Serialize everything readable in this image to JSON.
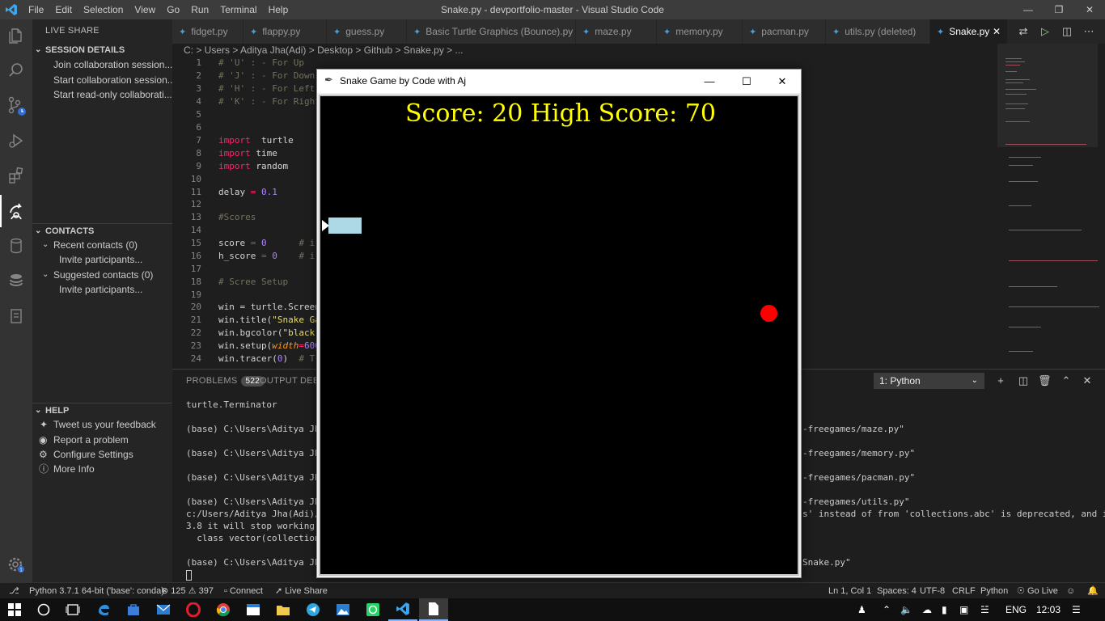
{
  "titlebar": {
    "menu": [
      "File",
      "Edit",
      "Selection",
      "View",
      "Go",
      "Run",
      "Terminal",
      "Help"
    ],
    "title": "Snake.py - devportfolio-master - Visual Studio Code"
  },
  "sidebar": {
    "header": "LIVE SHARE",
    "session_title": "SESSION DETAILS",
    "session_items": [
      "Join collaboration session...",
      "Start collaboration session...",
      "Start read-only collaborati..."
    ],
    "contacts_title": "CONTACTS",
    "recent_contacts": "Recent contacts (0)",
    "invite_recent": "Invite participants...",
    "suggested_contacts": "Suggested contacts (0)",
    "invite_suggested": "Invite participants...",
    "help_title": "HELP",
    "help_items": [
      "Tweet us your feedback",
      "Report a problem",
      "Configure Settings",
      "More Info"
    ]
  },
  "tabs": [
    "fidget.py",
    "flappy.py",
    "guess.py",
    "Basic Turtle Graphics (Bounce).py",
    "maze.py",
    "memory.py",
    "pacman.py",
    "utils.py (deleted)",
    "Snake.py"
  ],
  "breadcrumb": "C: > Users > Aditya Jha(Adi) > Desktop > Github > Snake.py > ...",
  "editor": {
    "line_numbers": [
      "1",
      "2",
      "3",
      "4",
      "5",
      "6",
      "7",
      "8",
      "9",
      "10",
      "11",
      "12",
      "13",
      "14",
      "15",
      "16",
      "17",
      "18",
      "19",
      "20",
      "21",
      "22",
      "23",
      "24"
    ],
    "lines": {
      "l1": "# 'U' : - For Up",
      "l2": "# 'J' : - For Down",
      "l3": "# 'H' : - For Left",
      "l4": "# 'K' : - For Right",
      "l7_kw": "import",
      "l7_rest": "  turtle",
      "l8_kw": "import",
      "l8_rest": " time",
      "l9_kw": "import",
      "l9_rest": " random",
      "l11_a": "delay",
      "l11_op": " = ",
      "l11_n": "0.1",
      "l13": "#Scores",
      "l15_a": "score",
      "l15_op": " = ",
      "l15_n": "0",
      "l15_c": "      # i",
      "l16_a": "h_score",
      "l16_op": " = ",
      "l16_n": "0",
      "l16_c": "    # i",
      "l18": "# Scree Setup",
      "l20": "win = turtle.Screen",
      "l21_a": "win.title(",
      "l21_s": "\"Snake Ga",
      "l22_a": "win.bgcolor(",
      "l22_s": "\"black\"",
      "l23_a": "win.setup(",
      "l23_arg": "width",
      "l23_b": "=",
      "l23_n": "600",
      "l24_a": "win.tracer(",
      "l24_n": "0",
      "l24_b": ")",
      "l24_c": "  # T"
    }
  },
  "panel": {
    "problems_label": "PROBLEMS",
    "problems_count": "522",
    "output_label": "OUTPUT",
    "debug_label": "DEBU",
    "terminal_select": "1: Python",
    "terminal_left": [
      "turtle.Terminator",
      "(base) C:\\Users\\Aditya Jha(",
      "(base) C:\\Users\\Aditya Jha(",
      "(base) C:\\Users\\Aditya Jha(",
      "(base) C:\\Users\\Aditya Jha(",
      "c:/Users/Aditya Jha(Adi)/De",
      "3.8 it will stop working",
      "  class vector(collections.",
      "(base) C:\\Users\\Aditya Jha("
    ],
    "terminal_right": [
      "-freegames/maze.py\"",
      "-freegames/memory.py\"",
      "-freegames/pacman.py\"",
      "-freegames/utils.py\"",
      "s' instead of from 'collections.abc' is deprecated, and in",
      "Snake.py\""
    ]
  },
  "statusbar": {
    "python": "Python 3.7.1 64-bit ('base': conda)",
    "errors": "125",
    "warnings": "397",
    "connect": "Connect",
    "liveshare": "Live Share",
    "position": "Ln 1, Col 1",
    "spaces": "Spaces: 4",
    "encoding": "UTF-8",
    "eol": "CRLF",
    "language": "Python",
    "golive": "Go Live"
  },
  "taskbar": {
    "language": "ENG",
    "time": "12:03"
  },
  "turtle_window": {
    "title": "Snake Game by Code with Aj",
    "score_text": "Score: 20 High Score: 70"
  },
  "colors": {
    "accent": "#007acc",
    "snake": "#add8e6",
    "food": "#ff0000",
    "score": "#ffff00"
  }
}
